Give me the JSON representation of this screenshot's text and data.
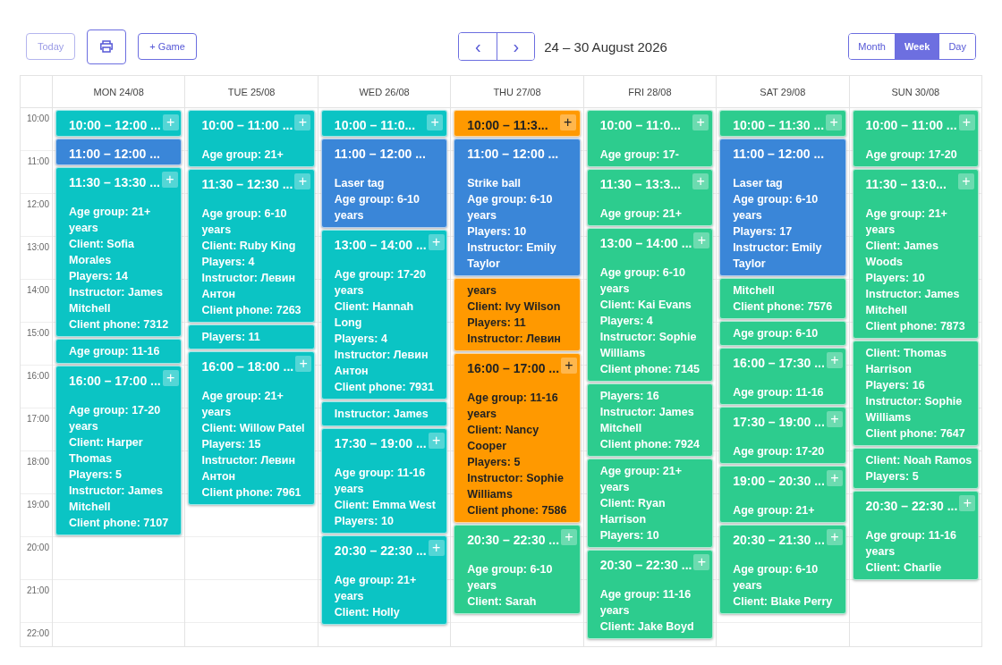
{
  "toolbar": {
    "today": {
      "label": "Today",
      "disabled": true
    },
    "add_game": {
      "label": "+ Game"
    },
    "prev": "‹",
    "next": "›",
    "range_title": "24 – 30 August 2026",
    "views": [
      {
        "label": "Month",
        "selected": false
      },
      {
        "label": "Week",
        "selected": true
      },
      {
        "label": "Day",
        "selected": false
      }
    ]
  },
  "days": [
    {
      "label": "MON 24/08",
      "events": [
        {
          "title": "10:00 – 12:00 ...",
          "color": "#0bc4c4",
          "add_button": "+"
        },
        {
          "title": "11:00 – 12:00 ...",
          "color": "#3a86d8"
        },
        {
          "title": "11:30 – 13:30 ...",
          "color": "#0bc4c4",
          "add_button": "+",
          "lines": [
            "Age group: 21+ years",
            "Client: Sofia Morales",
            "Players: 14",
            "Instructor: James Mitchell",
            "Client phone: 7312"
          ]
        },
        {
          "color": "#0bc4c4",
          "lines": [
            "Age group: 11-16"
          ]
        },
        {
          "title": "16:00 – 17:00 ...",
          "color": "#0bc4c4",
          "add_button": "+",
          "lines": [
            "Age group: 17-20 years",
            "Client: Harper Thomas",
            "Players: 5",
            "Instructor: James Mitchell",
            "Client phone: 7107"
          ]
        }
      ]
    },
    {
      "label": "TUE 25/08",
      "events": [
        {
          "title": "10:00 – 11:00 ...",
          "color": "#0bc4c4",
          "add_button": "+",
          "lines": [
            "Age group: 21+"
          ]
        },
        {
          "title": "11:30 – 12:30 ...",
          "color": "#0bc4c4",
          "add_button": "+",
          "lines": [
            "Age group: 6-10 years",
            "Client: Ruby King",
            "Players: 4",
            "Instructor: Левин Антон",
            "Client phone: 7263"
          ]
        },
        {
          "color": "#0bc4c4",
          "lines": [
            "Players: 11"
          ]
        },
        {
          "title": "16:00 – 18:00 ...",
          "color": "#0bc4c4",
          "add_button": "+",
          "lines": [
            "Age group: 21+ years",
            "Client: Willow Patel",
            "Players: 15",
            "Instructor: Левин Антон",
            "Client phone: 7961"
          ]
        }
      ]
    },
    {
      "label": "WED 26/08",
      "events": [
        {
          "title": "10:00 – 11:0...",
          "color": "#0bc4c4",
          "add_button": "+"
        },
        {
          "title": "11:00 – 12:00 ...",
          "color": "#3a86d8",
          "lines": [
            "Laser tag",
            "Age group: 6-10 years"
          ]
        },
        {
          "title": "13:00 – 14:00 ...",
          "color": "#0bc4c4",
          "add_button": "+",
          "lines": [
            "Age group: 17-20 years",
            "Client: Hannah Long",
            "Players: 4",
            "Instructor: Левин Антон",
            "Client phone: 7931"
          ]
        },
        {
          "color": "#0bc4c4",
          "lines": [
            "Instructor: James"
          ]
        },
        {
          "title": "17:30 – 19:00 ...",
          "color": "#0bc4c4",
          "add_button": "+",
          "lines": [
            "Age group: 11-16 years",
            "Client: Emma West",
            "Players: 10"
          ]
        },
        {
          "title": "20:30 – 22:30 ...",
          "color": "#0bc4c4",
          "add_button": "+",
          "lines": [
            "Age group: 21+ years",
            "Client: Holly"
          ]
        }
      ]
    },
    {
      "label": "THU 27/08",
      "events": [
        {
          "title": "10:00 – 11:3...",
          "color": "#ff9900",
          "add_button": "+"
        },
        {
          "title": "11:00 – 12:00 ...",
          "color": "#3a86d8",
          "lines": [
            "Strike ball",
            "Age group: 6-10 years",
            "Players: 10",
            "Instructor: Emily Taylor"
          ]
        },
        {
          "color": "#ff9900",
          "lines": [
            "years",
            "Client: Ivy Wilson",
            "Players: 11",
            "Instructor: Левин"
          ]
        },
        {
          "title": "16:00 – 17:00 ...",
          "color": "#ff9900",
          "add_button": "+",
          "lines": [
            "Age group: 11-16 years",
            "Client: Nancy Cooper",
            "Players: 5",
            "Instructor: Sophie Williams",
            "Client phone: 7586"
          ]
        },
        {
          "title": "20:30 – 22:30 ...",
          "color": "#2dcc8e",
          "add_button": "+",
          "lines": [
            "Age group: 6-10 years",
            "Client: Sarah"
          ]
        }
      ]
    },
    {
      "label": "FRI 28/08",
      "events": [
        {
          "title": "10:00 – 11:0...",
          "color": "#2dcc8e",
          "add_button": "+",
          "lines": [
            "Age group: 17-"
          ]
        },
        {
          "title": "11:30 – 13:3...",
          "color": "#2dcc8e",
          "add_button": "+",
          "lines": [
            "Age group: 21+"
          ]
        },
        {
          "title": "13:00 – 14:00 ...",
          "color": "#2dcc8e",
          "add_button": "+",
          "lines": [
            "Age group: 6-10 years",
            "Client: Kai Evans",
            "Players: 4",
            "Instructor: Sophie Williams",
            "Client phone: 7145"
          ]
        },
        {
          "color": "#2dcc8e",
          "lines": [
            "Players: 16",
            "Instructor: James Mitchell",
            "Client phone: 7924"
          ]
        },
        {
          "color": "#2dcc8e",
          "lines": [
            "Age group: 21+ years",
            "Client: Ryan Harrison",
            "Players: 10"
          ]
        },
        {
          "title": "20:30 – 22:30 ...",
          "color": "#2dcc8e",
          "add_button": "+",
          "lines": [
            "Age group: 11-16 years",
            "Client: Jake Boyd"
          ]
        }
      ]
    },
    {
      "label": "SAT 29/08",
      "events": [
        {
          "title": "10:00 – 11:30 ...",
          "color": "#2dcc8e",
          "add_button": "+"
        },
        {
          "title": "11:00 – 12:00 ...",
          "color": "#3a86d8",
          "lines": [
            "Laser tag",
            "Age group: 6-10 years",
            "Players: 17",
            "Instructor: Emily Taylor"
          ]
        },
        {
          "color": "#2dcc8e",
          "lines": [
            "Mitchell",
            "Client phone: 7576"
          ]
        },
        {
          "color": "#2dcc8e",
          "lines": [
            "Age group: 6-10"
          ]
        },
        {
          "title": "16:00 – 17:30 ...",
          "color": "#2dcc8e",
          "add_button": "+",
          "lines": [
            "Age group: 11-16"
          ]
        },
        {
          "title": "17:30 – 19:00 ...",
          "color": "#2dcc8e",
          "add_button": "+",
          "lines": [
            "Age group: 17-20"
          ]
        },
        {
          "title": "19:00 – 20:30 ...",
          "color": "#2dcc8e",
          "add_button": "+",
          "lines": [
            "Age group: 21+"
          ]
        },
        {
          "title": "20:30 – 21:30 ...",
          "color": "#2dcc8e",
          "add_button": "+",
          "lines": [
            "Age group: 6-10 years",
            "Client: Blake Perry"
          ]
        }
      ]
    },
    {
      "label": "SUN 30/08",
      "events": [
        {
          "title": "10:00 – 11:00 ...",
          "color": "#2dcc8e",
          "add_button": "+",
          "lines": [
            "Age group: 17-20"
          ]
        },
        {
          "title": "11:30 – 13:0...",
          "color": "#2dcc8e",
          "add_button": "+",
          "lines": [
            "Age group: 21+ years",
            "Client: James Woods",
            "Players: 10",
            "Instructor: James Mitchell",
            "Client phone: 7873"
          ]
        },
        {
          "color": "#2dcc8e",
          "lines": [
            "Client: Thomas Harrison",
            "Players: 16",
            "Instructor: Sophie Williams",
            "Client phone: 7647"
          ]
        },
        {
          "color": "#2dcc8e",
          "lines": [
            "Client: Noah Ramos",
            "Players: 5"
          ]
        },
        {
          "title": "20:30 – 22:30 ...",
          "color": "#2dcc8e",
          "add_button": "+",
          "lines": [
            "Age group: 11-16 years",
            "Client: Charlie"
          ]
        }
      ]
    }
  ],
  "time_labels": [
    "10:00",
    "11:00",
    "12:00",
    "13:00",
    "14:00",
    "15:00",
    "16:00",
    "17:00",
    "18:00",
    "19:00",
    "20:00",
    "21:00",
    "22:00"
  ]
}
